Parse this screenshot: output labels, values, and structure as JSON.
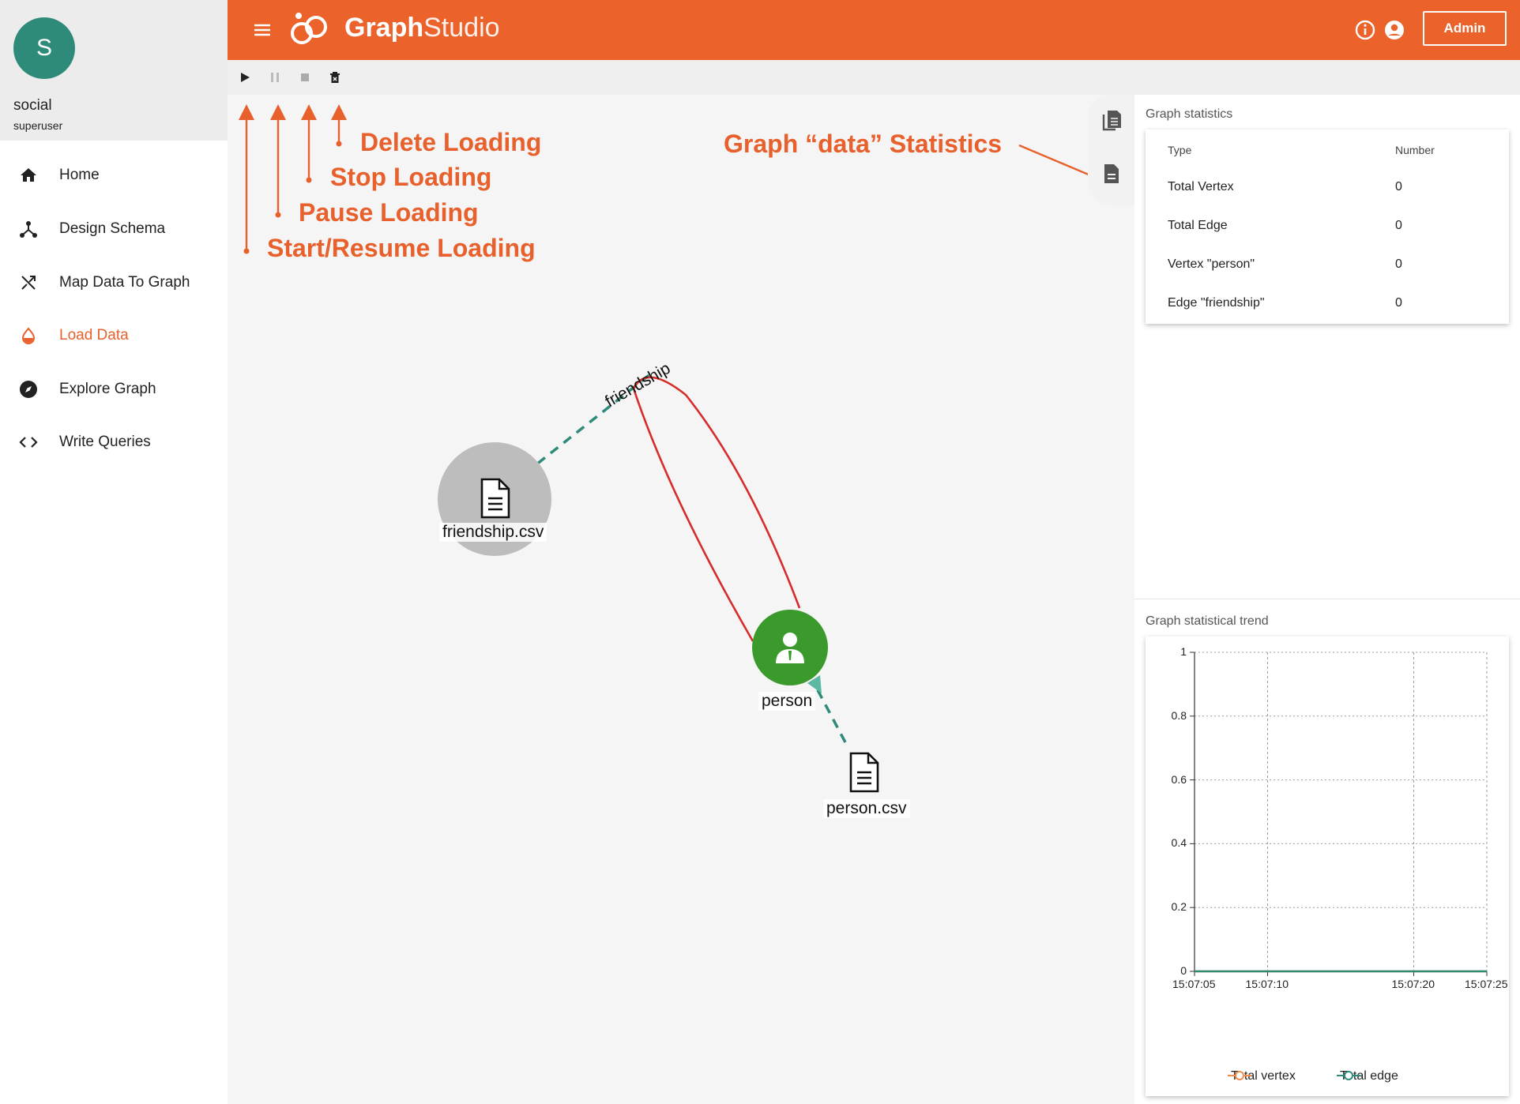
{
  "user": {
    "initial": "S",
    "name": "social",
    "role": "superuser"
  },
  "nav": [
    {
      "label": "Home",
      "icon": "home-icon"
    },
    {
      "label": "Design Schema",
      "icon": "schema-icon"
    },
    {
      "label": "Map Data To Graph",
      "icon": "map-icon"
    },
    {
      "label": "Load Data",
      "icon": "load-data-icon",
      "active": true
    },
    {
      "label": "Explore Graph",
      "icon": "compass-icon"
    },
    {
      "label": "Write Queries",
      "icon": "code-icon"
    }
  ],
  "header": {
    "logo_bold": "Graph",
    "logo_light": "Studio",
    "admin_label": "Admin"
  },
  "toolbar": {
    "buttons": [
      "play-icon",
      "pause-icon",
      "stop-icon",
      "delete-icon"
    ]
  },
  "annotations": {
    "delete": "Delete Loading",
    "stop": "Stop Loading",
    "pause": "Pause Loading",
    "start": "Start/Resume Loading",
    "stats": "Graph “data” Statistics"
  },
  "graph": {
    "file_nodes": [
      "friendship.csv",
      "person.csv"
    ],
    "vertex": "person",
    "edge": "friendship"
  },
  "stats": {
    "title": "Graph statistics",
    "col_type": "Type",
    "col_number": "Number",
    "rows": [
      {
        "type": "Total Vertex",
        "number": "0"
      },
      {
        "type": "Total Edge",
        "number": "0"
      },
      {
        "type": "Vertex \"person\"",
        "number": "0"
      },
      {
        "type": "Edge \"friendship\"",
        "number": "0"
      }
    ]
  },
  "trend": {
    "title": "Graph statistical trend",
    "legend": [
      "Total vertex",
      "Total edge"
    ]
  },
  "colors": {
    "brand": "#eb622b",
    "accent": "#e8602c",
    "vertex": "#3a9a2c",
    "file_node": "#bdbdbd",
    "edge_dash": "#2e8b79",
    "edge_red": "#d62c2c"
  },
  "chart_data": {
    "type": "line",
    "title": "Graph statistical trend",
    "xlabel": "",
    "ylabel": "",
    "x": [
      "15:07:05",
      "15:07:10",
      "15:07:20",
      "15:07:25"
    ],
    "yticks": [
      "0",
      "0.2",
      "0.4",
      "0.6",
      "0.8",
      "1"
    ],
    "ylim": [
      0,
      1
    ],
    "grid": true,
    "legend": "bottom",
    "series": [
      {
        "name": "Total vertex",
        "values": [
          0,
          0,
          0,
          0
        ],
        "color": "#f28b50"
      },
      {
        "name": "Total edge",
        "values": [
          0,
          0,
          0,
          0
        ],
        "color": "#2e8b79"
      }
    ]
  }
}
